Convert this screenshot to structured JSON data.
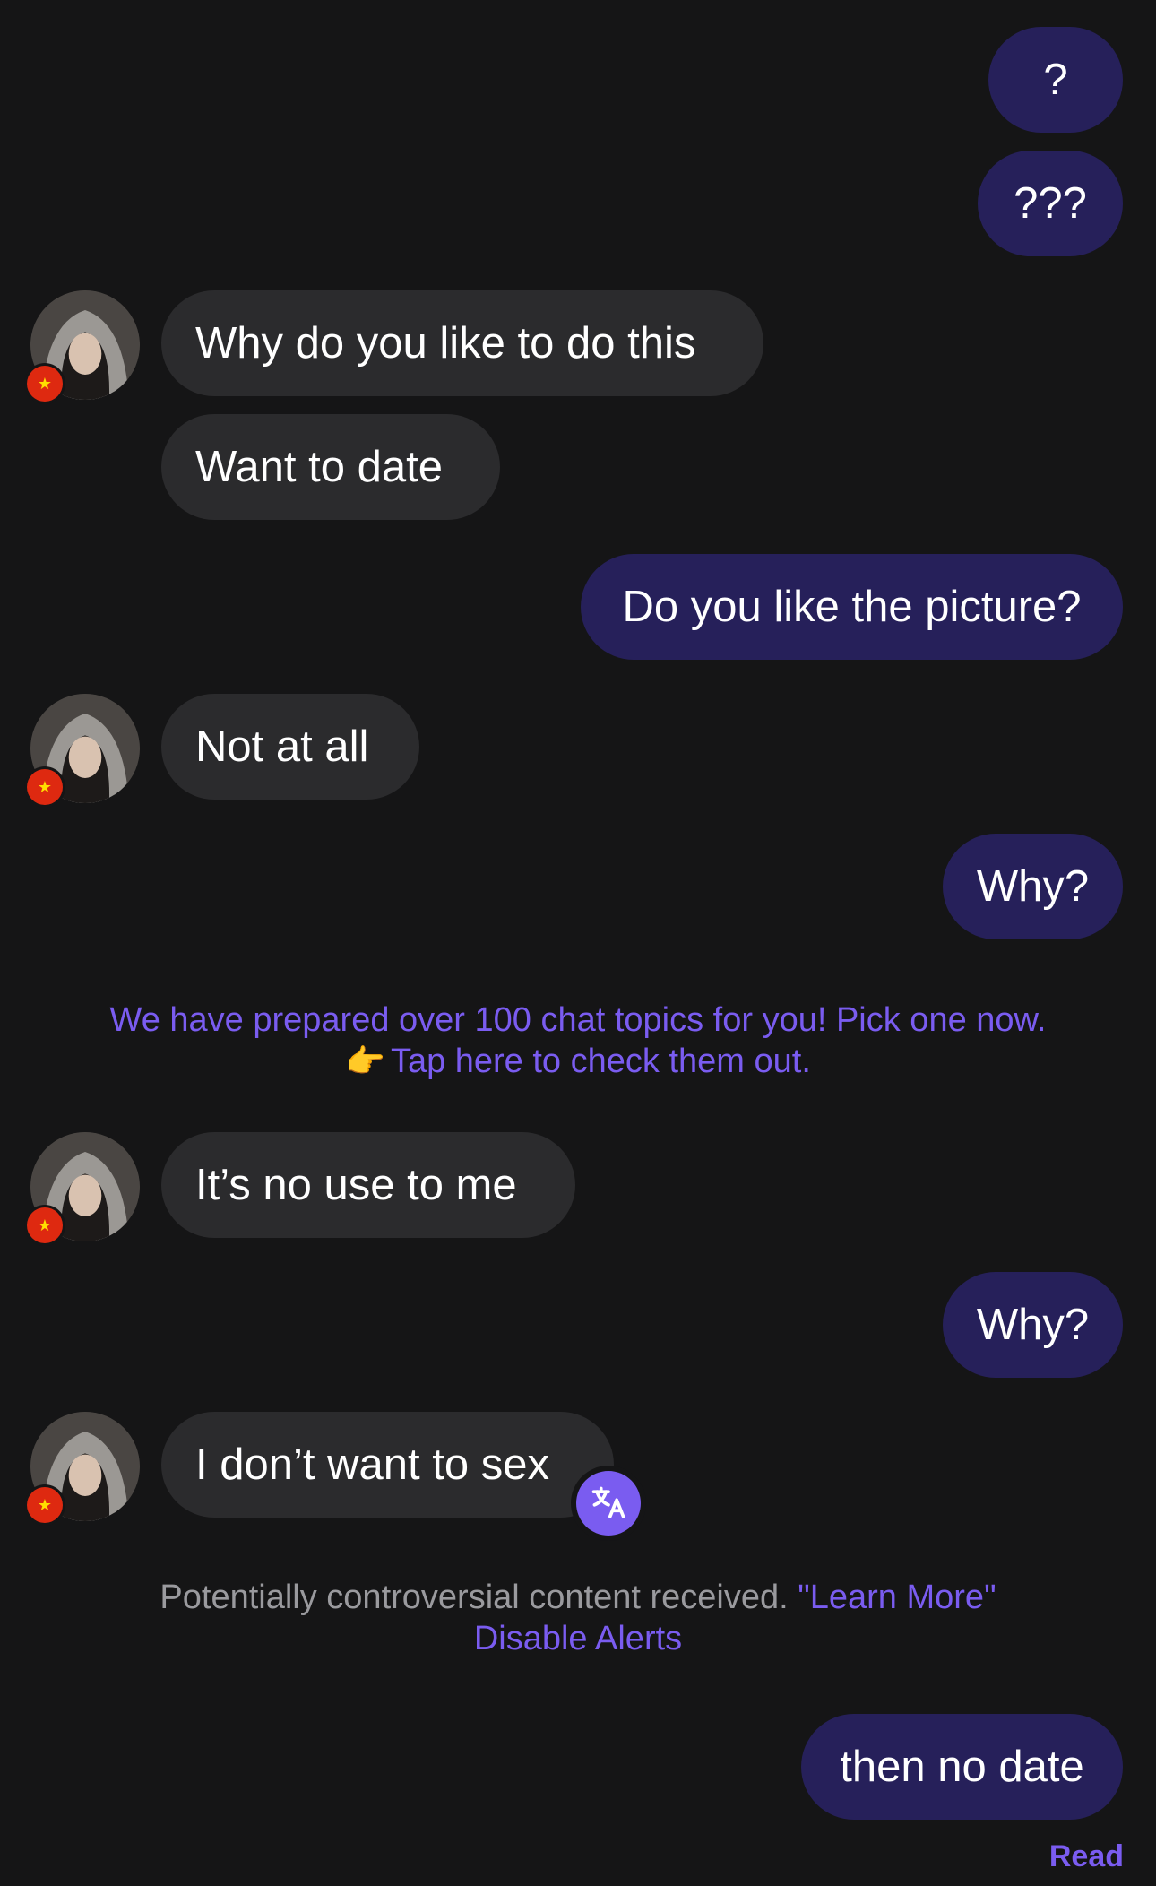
{
  "messages": [
    {
      "dir": "out",
      "text": "?"
    },
    {
      "dir": "out",
      "text": "???"
    },
    {
      "dir": "in",
      "text": "Why do you like to do this"
    },
    {
      "dir": "in",
      "text": "Want to date"
    },
    {
      "dir": "out",
      "text": "Do you like the picture?"
    },
    {
      "dir": "in",
      "text": "Not at all"
    },
    {
      "dir": "out",
      "text": "Why?"
    },
    {
      "dir": "in",
      "text": "It’s no use to me"
    },
    {
      "dir": "out",
      "text": "Why?"
    },
    {
      "dir": "in",
      "text": "I don’t want to sex"
    },
    {
      "dir": "out",
      "text": "then no date"
    }
  ],
  "topics_banner": {
    "line1": "We have prepared over 100 chat topics for you! Pick one now.",
    "pointer_emoji": "👉",
    "line2": "Tap here to check them out."
  },
  "content_warning": {
    "text": "Potentially controversial content received.",
    "learn_more": "\"Learn More\"",
    "disable_alerts": "Disable Alerts"
  },
  "status": {
    "read": "Read"
  },
  "avatar": {
    "flag_icon": "china-flag-icon"
  },
  "colors": {
    "background": "#151516",
    "outgoing_bubble": "#26205a",
    "incoming_bubble": "#2b2b2d",
    "accent": "#7a5cf0",
    "muted_text": "#9a9a9e"
  }
}
